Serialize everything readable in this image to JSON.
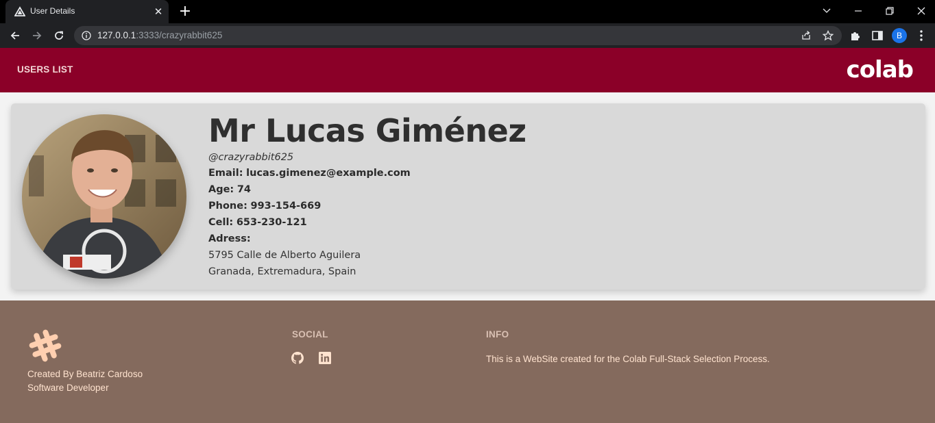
{
  "browser": {
    "tab_title": "User Details",
    "url_host": "127.0.0.1",
    "url_rest": ":3333/crazyrabbit625",
    "profile_initial": "B"
  },
  "header": {
    "nav_link": "USERS LIST",
    "brand": "colab",
    "bg_color": "#8b0028"
  },
  "user": {
    "name": "Mr Lucas Giménez",
    "username": "@crazyrabbit625",
    "email_label": "Email:",
    "email": "lucas.gimenez@example.com",
    "age_label": "Age:",
    "age": "74",
    "phone_label": "Phone:",
    "phone": "993-154-669",
    "cell_label": "Cell:",
    "cell": "653-230-121",
    "address_label": "Adress:",
    "address_line1": "5795 Calle de Alberto Aguilera",
    "address_line2": "Granada, Extremadura, Spain"
  },
  "footer": {
    "credit_line1": "Created By Beatriz Cardoso",
    "credit_line2": "Software Developer",
    "social_heading": "SOCIAL",
    "social_icons": [
      "github-icon",
      "linkedin-icon"
    ],
    "info_heading": "INFO",
    "info_text": "This is a WebSite created for the Colab Full-Stack Selection Process.",
    "bg_color": "#846a5d"
  }
}
